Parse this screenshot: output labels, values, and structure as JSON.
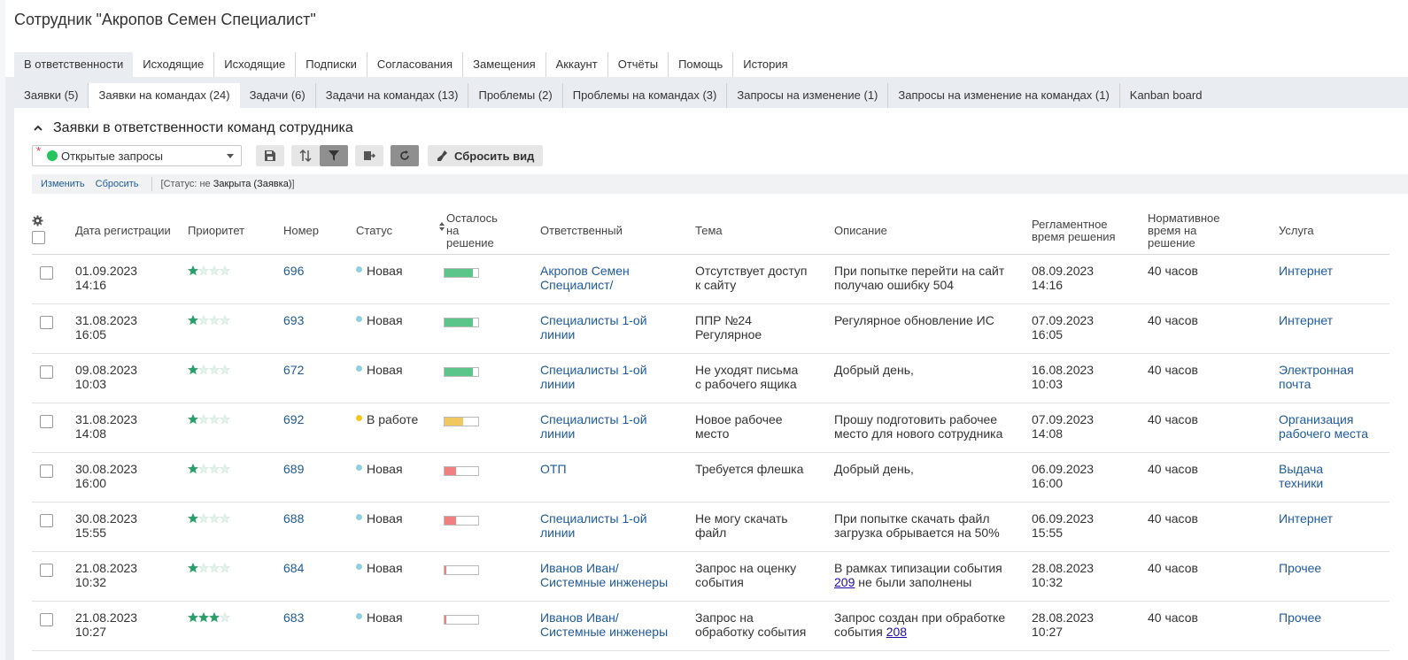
{
  "title": "Сотрудник \"Акропов Семен Специалист\"",
  "tabs_main": [
    {
      "label": "В ответственности",
      "active": true
    },
    {
      "label": "Исходящие"
    },
    {
      "label": "Исходящие"
    },
    {
      "label": "Подписки"
    },
    {
      "label": "Согласования"
    },
    {
      "label": "Замещения"
    },
    {
      "label": "Аккаунт"
    },
    {
      "label": "Отчёты"
    },
    {
      "label": "Помощь"
    },
    {
      "label": "История"
    }
  ],
  "tabs_sub": [
    {
      "label": "Заявки (5)"
    },
    {
      "label": "Заявки на командах (24)",
      "active": true
    },
    {
      "label": "Задачи (6)"
    },
    {
      "label": "Задачи на командах (13)"
    },
    {
      "label": "Проблемы (2)"
    },
    {
      "label": "Проблемы на командах (3)"
    },
    {
      "label": "Запросы на изменение (1)"
    },
    {
      "label": "Запросы на изменение на командах (1)"
    },
    {
      "label": "Kanban board"
    }
  ],
  "section_title": "Заявки в ответственности команд сотрудника",
  "filter": {
    "required_mark": "*",
    "value": "Открытые запросы",
    "dot_color": "#22c55e"
  },
  "toolbar": {
    "reset_view": "Сбросить вид"
  },
  "filterbar": {
    "change": "Изменить",
    "reset": "Сбросить",
    "criteria_prefix": "[Статус: не ",
    "criteria_value": "Закрыта (Заявка)",
    "criteria_suffix": "]"
  },
  "columns": {
    "date": "Дата регистрации",
    "priority": "Приоритет",
    "number": "Номер",
    "status": "Статус",
    "remaining": "Осталось на решение",
    "responsible": "Ответственный",
    "subject": "Тема",
    "description": "Описание",
    "deadline": "Регламентное время решения",
    "norm": "Нормативное время на решение",
    "service": "Услуга"
  },
  "colors": {
    "new": "#8fd0e0",
    "in_work": "#f5c518",
    "green": "#5cc58a",
    "yellow": "#f0c860",
    "red": "#f08080"
  },
  "rows": [
    {
      "date": "01.09.2023",
      "time": "14:16",
      "stars": 1,
      "number": "696",
      "status": "Новая",
      "status_color": "#8fd0e0",
      "progress": 0.85,
      "progress_color": "#5cc58a",
      "resp1": "Акропов Семен",
      "resp2": "Специалист/",
      "subj1": "Отсутствует доступ",
      "subj2": "к сайту",
      "desc1": "При попытке перейти на сайт",
      "desc2": "получаю ошибку 504",
      "dl_date": "08.09.2023",
      "dl_time": "14:16",
      "norm": "40 часов",
      "svc1": "Интернет",
      "svc2": ""
    },
    {
      "date": "31.08.2023",
      "time": "16:05",
      "stars": 1,
      "number": "693",
      "status": "Новая",
      "status_color": "#8fd0e0",
      "progress": 0.85,
      "progress_color": "#5cc58a",
      "resp1": "Специалисты 1-ой",
      "resp2": "линии",
      "subj1": "ППР №24",
      "subj2": "Регулярное",
      "desc1": "Регулярное обновление ИС",
      "desc2": "",
      "dl_date": "07.09.2023",
      "dl_time": "16:05",
      "norm": "40 часов",
      "svc1": "Интернет",
      "svc2": ""
    },
    {
      "date": "09.08.2023",
      "time": "10:03",
      "stars": 1,
      "number": "672",
      "status": "Новая",
      "status_color": "#8fd0e0",
      "progress": 0.85,
      "progress_color": "#5cc58a",
      "resp1": "Специалисты 1-ой",
      "resp2": "линии",
      "subj1": "Не уходят письма",
      "subj2": "с рабочего ящика",
      "desc1": "Добрый день,",
      "desc2": "",
      "dl_date": "16.08.2023",
      "dl_time": "10:03",
      "norm": "40 часов",
      "svc1": "Электронная",
      "svc2": "почта"
    },
    {
      "date": "31.08.2023",
      "time": "14:08",
      "stars": 1,
      "number": "692",
      "status": "В работе",
      "status_color": "#f5c518",
      "progress": 0.55,
      "progress_color": "#f0c860",
      "resp1": "Специалисты 1-ой",
      "resp2": "линии",
      "subj1": "Новое рабочее",
      "subj2": "место",
      "desc1": "Прошу подготовить рабочее",
      "desc2": "место для нового сотрудника",
      "dl_date": "07.09.2023",
      "dl_time": "14:08",
      "norm": "40 часов",
      "svc1": "Организация",
      "svc2": "рабочего места"
    },
    {
      "date": "30.08.2023",
      "time": "16:00",
      "stars": 1,
      "number": "689",
      "status": "Новая",
      "status_color": "#8fd0e0",
      "progress": 0.35,
      "progress_color": "#f08080",
      "resp1": "ОТП",
      "resp2": "",
      "subj1": "Требуется флешка",
      "subj2": "",
      "desc1": "Добрый день,",
      "desc2": "",
      "dl_date": "06.09.2023",
      "dl_time": "16:00",
      "norm": "40 часов",
      "svc1": "Выдача",
      "svc2": "техники"
    },
    {
      "date": "30.08.2023",
      "time": "15:55",
      "stars": 1,
      "number": "688",
      "status": "Новая",
      "status_color": "#8fd0e0",
      "progress": 0.35,
      "progress_color": "#f08080",
      "resp1": "Специалисты 1-ой",
      "resp2": "линии",
      "subj1": "Не могу скачать",
      "subj2": "файл",
      "desc1": "При попытке скачать файл",
      "desc2": "загрузка обрывается на 50%",
      "dl_date": "06.09.2023",
      "dl_time": "15:55",
      "norm": "40 часов",
      "svc1": "Интернет",
      "svc2": ""
    },
    {
      "date": "21.08.2023",
      "time": "10:32",
      "stars": 1,
      "number": "684",
      "status": "Новая",
      "status_color": "#8fd0e0",
      "progress": 0.05,
      "progress_color": "#f08080",
      "resp1": "Иванов Иван/",
      "resp2": "Системные инженеры",
      "subj1": "Запрос на оценку",
      "subj2": "события",
      "desc1": "В рамках типизации события",
      "desc2_link": "209",
      "desc2": " не были заполнены",
      "dl_date": "28.08.2023",
      "dl_time": "10:32",
      "norm": "40 часов",
      "svc1": "Прочее",
      "svc2": ""
    },
    {
      "date": "21.08.2023",
      "time": "10:27",
      "stars": 3,
      "number": "683",
      "status": "Новая",
      "status_color": "#8fd0e0",
      "progress": 0.05,
      "progress_color": "#f08080",
      "resp1": "Иванов Иван/",
      "resp2": "Системные инженеры",
      "subj1": "Запрос на",
      "subj2": "обработку события",
      "desc1": "Запрос создан при обработке",
      "desc2_pre": "события ",
      "desc2_link": "208",
      "desc2": "",
      "dl_date": "28.08.2023",
      "dl_time": "10:27",
      "norm": "40 часов",
      "svc1": "Прочее",
      "svc2": ""
    }
  ]
}
